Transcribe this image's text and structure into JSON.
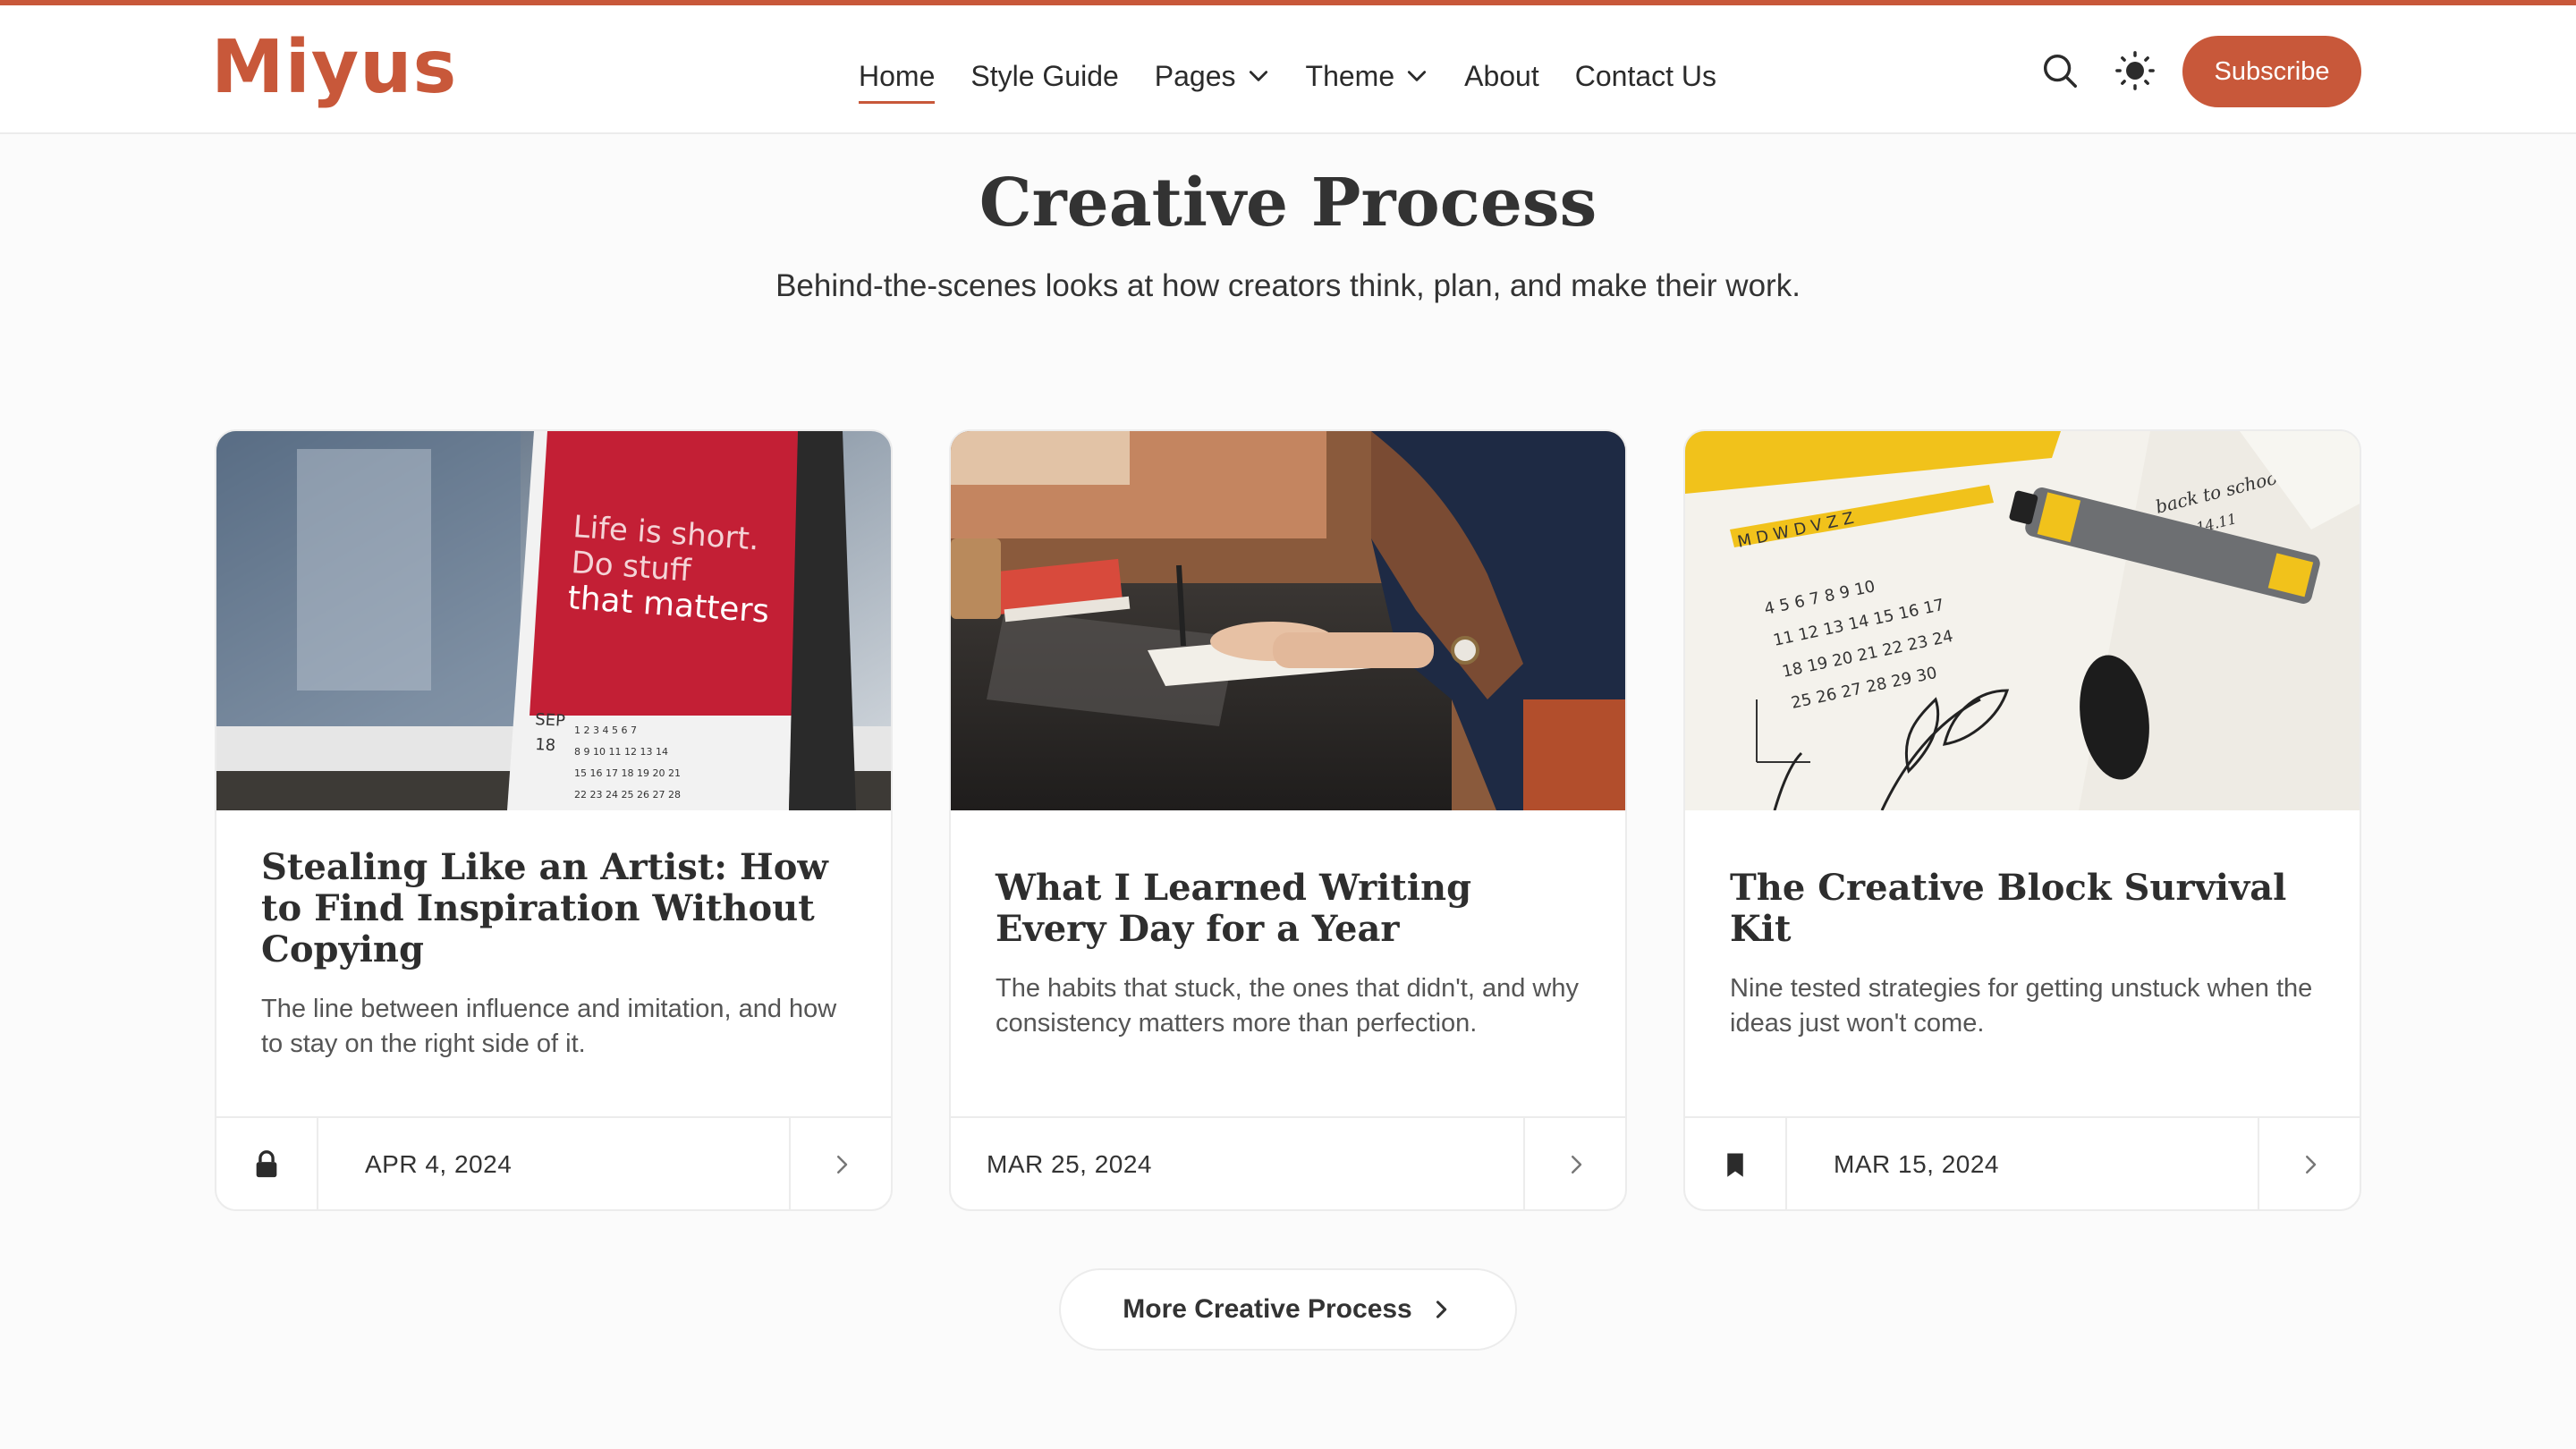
{
  "brand": {
    "logo": "Miyus",
    "accent": "#c8583a"
  },
  "nav": {
    "items": [
      {
        "label": "Home",
        "active": true,
        "dropdown": false
      },
      {
        "label": "Style Guide",
        "active": false,
        "dropdown": false
      },
      {
        "label": "Pages",
        "active": false,
        "dropdown": true
      },
      {
        "label": "Theme",
        "active": false,
        "dropdown": true
      },
      {
        "label": "About",
        "active": false,
        "dropdown": false
      },
      {
        "label": "Contact Us",
        "active": false,
        "dropdown": false
      }
    ],
    "search_icon": "search-icon",
    "theme_icon": "sun-icon",
    "subscribe_label": "Subscribe"
  },
  "page": {
    "title": "Creative Process",
    "subtitle": "Behind-the-scenes looks at how creators think, plan, and make their work."
  },
  "cards": [
    {
      "title": "Stealing Like an Artist: How to Find Inspiration Without Copying",
      "description": "The line between influence and imitation, and how to stay on the right side of it.",
      "date": "APR 4, 2024",
      "badge_icon": "lock-icon",
      "image_text": [
        "Life is short.",
        "Do stuff",
        "that matters"
      ],
      "image_month": "SEP",
      "image_day": "18"
    },
    {
      "title": "What I Learned Writing Every Day for a Year",
      "description": "The habits that stuck, the ones that didn't, and why consistency matters more than perfection.",
      "date": "MAR 25, 2024",
      "badge_icon": null
    },
    {
      "title": "The Creative Block Survival Kit",
      "description": "Nine tested strategies for getting unstuck when the ideas just won't come.",
      "date": "MAR 15, 2024",
      "badge_icon": "bookmark-icon",
      "image_text": [
        "back to school",
        "10-14.11"
      ]
    }
  ],
  "more_button": {
    "label": "More Creative Process"
  }
}
